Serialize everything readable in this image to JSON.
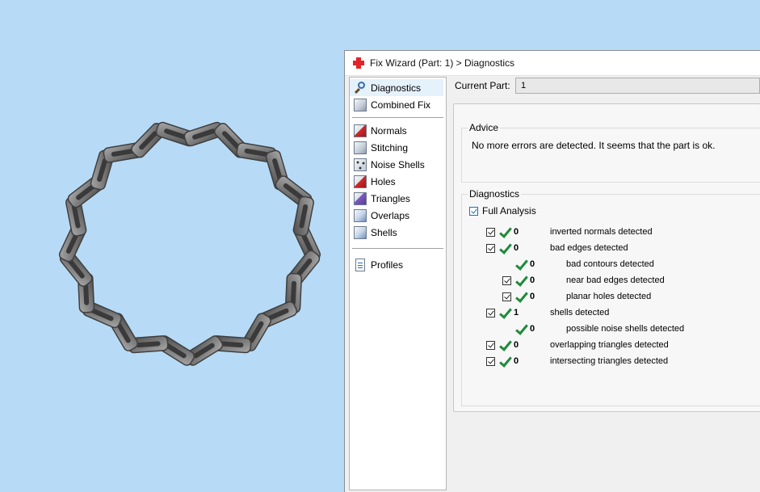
{
  "window": {
    "title": "Fix Wizard (Part: 1) > Diagnostics"
  },
  "nav": {
    "top": [
      {
        "label": "Diagnostics",
        "icon": "magnifier-icon",
        "selected": true
      },
      {
        "label": "Combined Fix",
        "icon": "cube-icon"
      }
    ],
    "tools": [
      {
        "label": "Normals",
        "icon": "normals-cube-icon"
      },
      {
        "label": "Stitching",
        "icon": "stitching-cube-icon"
      },
      {
        "label": "Noise Shells",
        "icon": "noise-shells-cube-icon"
      },
      {
        "label": "Holes",
        "icon": "holes-cube-icon"
      },
      {
        "label": "Triangles",
        "icon": "triangles-cube-icon"
      },
      {
        "label": "Overlaps",
        "icon": "overlaps-cube-icon"
      },
      {
        "label": "Shells",
        "icon": "shells-cube-icon"
      }
    ],
    "bottom": [
      {
        "label": "Profiles",
        "icon": "document-icon"
      }
    ]
  },
  "current_part": {
    "label": "Current Part:",
    "value": "1"
  },
  "advice": {
    "title": "Advice",
    "text": "No more errors are detected. It seems that the part is ok."
  },
  "diagnostics": {
    "title": "Diagnostics",
    "full_analysis_label": "Full Analysis",
    "full_analysis_checked": true,
    "rows": [
      {
        "count": "0",
        "label": "inverted normals detected",
        "indent": 0,
        "checkbox": true
      },
      {
        "count": "0",
        "label": "bad edges detected",
        "indent": 0,
        "checkbox": true
      },
      {
        "count": "0",
        "label": "bad contours detected",
        "indent": 1,
        "checkbox": false
      },
      {
        "count": "0",
        "label": "near bad edges detected",
        "indent": 1,
        "checkbox": true
      },
      {
        "count": "0",
        "label": "planar holes detected",
        "indent": 1,
        "checkbox": true
      },
      {
        "count": "1",
        "label": "shells detected",
        "indent": 0,
        "checkbox": true
      },
      {
        "count": "0",
        "label": "possible noise shells detected",
        "indent": 1,
        "checkbox": false
      },
      {
        "count": "0",
        "label": "overlapping triangles detected",
        "indent": 0,
        "checkbox": true
      },
      {
        "count": "0",
        "label": "intersecting triangles detected",
        "indent": 0,
        "checkbox": true
      }
    ]
  },
  "colors": {
    "viewport_background": "#b7dbf6",
    "check_green": "#218a3c",
    "model_gray": "#7b7b7b"
  }
}
